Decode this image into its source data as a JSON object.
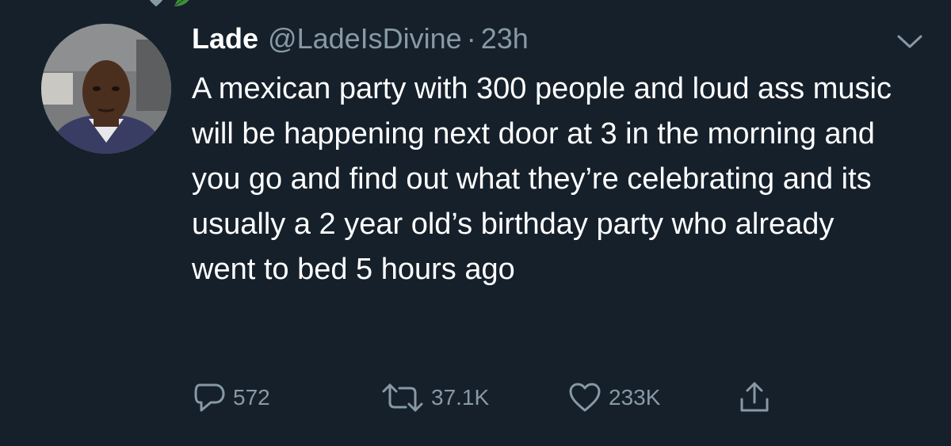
{
  "tweet": {
    "name": "Lade",
    "handle": "@LadeIsDivine",
    "separator": "·",
    "time": "23h",
    "text": "A mexican party with 300 people and loud ass music will be happening next door at 3 in the morning and you go and find out what they’re celebrating and its usually a 2 year old’s birthday party who already went to bed 5 hours ago"
  },
  "actions": {
    "replies": "572",
    "retweets": "37.1K",
    "likes": "233K"
  },
  "icons": {
    "reply": "reply-icon",
    "retweet": "retweet-icon",
    "like": "heart-icon",
    "share": "share-icon",
    "menu": "chevron-down-icon"
  },
  "colors": {
    "background": "#15202b",
    "text": "#ffffff",
    "muted": "#8899a6"
  }
}
